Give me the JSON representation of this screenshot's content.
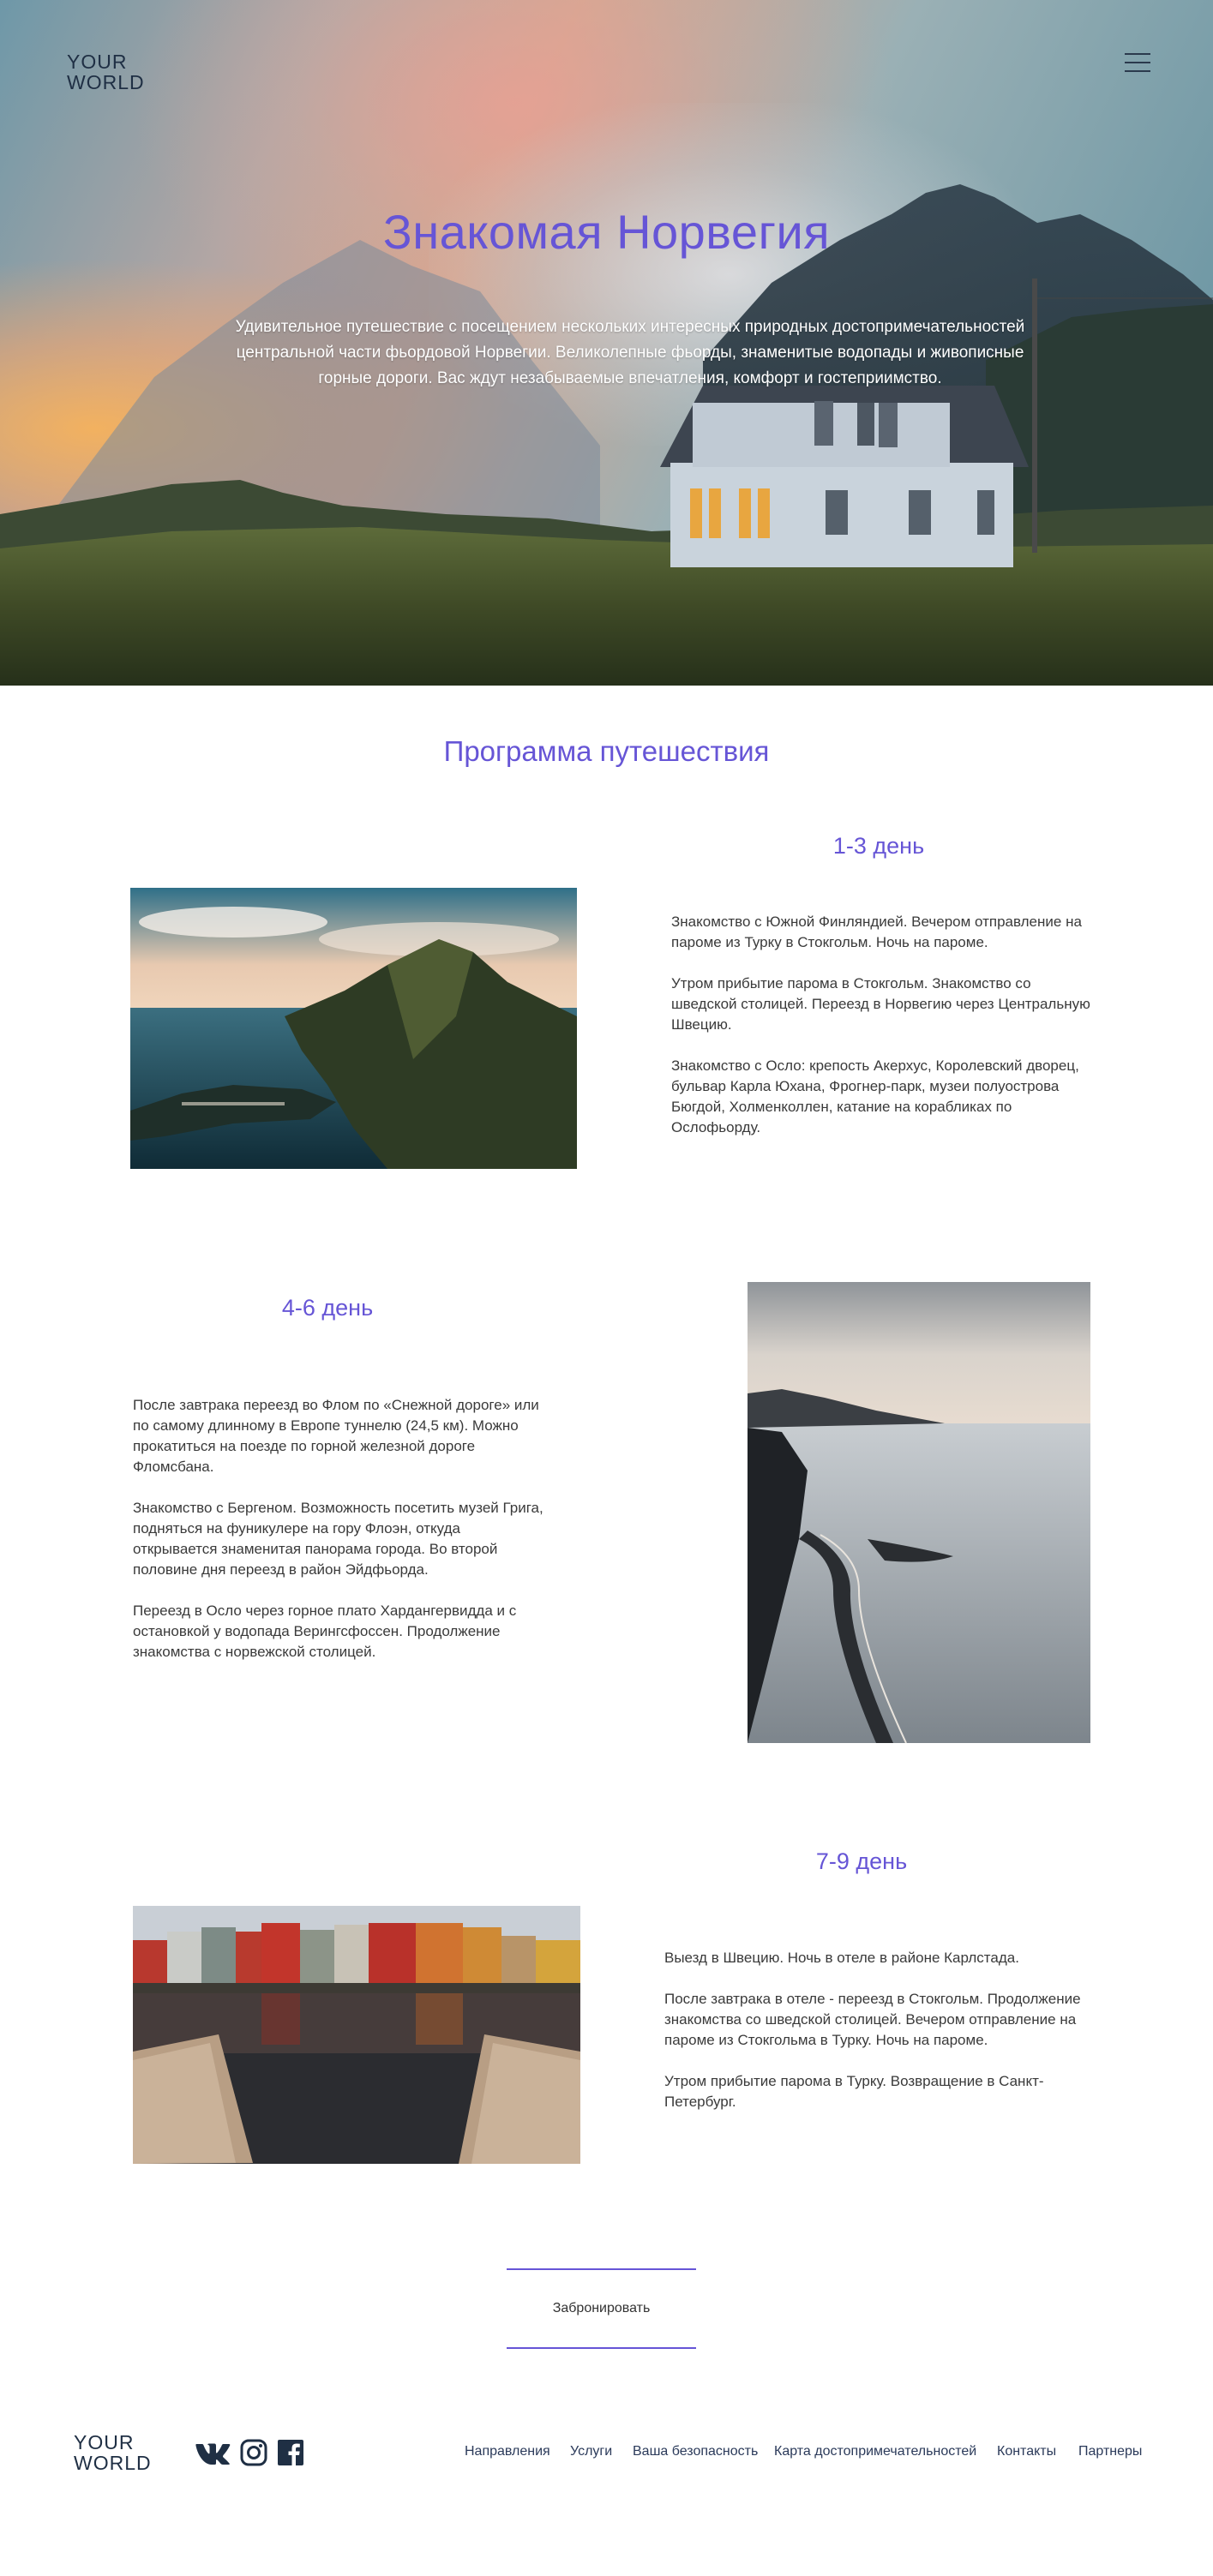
{
  "header": {
    "logo_line1": "YOUR",
    "logo_line2": "WORLD"
  },
  "hero": {
    "title": "Знакомая Норвегия",
    "description": "Удивительное путешествие с посещением нескольких интересных природных достопримечательностей центральной части фьордовой Норвегии. Великолепные фьорды, знаменитые водопады и живописные горные дороги. Вас ждут незабываемые впечатления, комфорт и гостеприимство."
  },
  "program": {
    "title": "Программа путешествия",
    "days": [
      {
        "title": "1-3 день",
        "paragraphs": [
          "Знакомство с Южной Финляндией. Вечером отправление на пароме из Турку в Стокгольм. Ночь на пароме.",
          "Утром прибытие парома в Стокгольм. Знакомство со шведской столицей. Переезд в Норвегию через Центральную Швецию.",
          "Знакомство с Осло: крепость Акерхус, Королевский дворец, бульвар Карла Юхана, Фрогнер-парк, музеи полуострова Бюгдой, Холменколлен, катание на корабликах по Ослофьорду."
        ]
      },
      {
        "title": "4-6 день",
        "paragraphs": [
          "После завтрака переезд во Флом по «Снежной дороге» или по самому длинному в Европе туннелю (24,5 км). Можно прокатиться на поезде по горной железной дороге Фломсбана.",
          "Знакомство с Бергеном. Возможность посетить музей Грига, подняться на фуникулере на гору Флоэн, откуда открывается знаменитая панорама города. Во второй половине дня переезд в район Эйдфьорда.",
          "Переезд в Осло через горное плато Хардангервидда и с остановкой у водопада Верингсфоссен. Продолжение знакомства с норвежской столицей."
        ]
      },
      {
        "title": "7-9 день",
        "paragraphs": [
          "Выезд в Швецию. Ночь в отеле в районе Карлстада.",
          "После завтрака в отеле - переезд в Стокгольм. Продолжение знакомства со шведской столицей. Вечером отправление на пароме из Стокгольма в Турку. Ночь на пароме.",
          "Утром прибытие парома в Турку. Возвращение в Санкт-Петербург."
        ]
      }
    ]
  },
  "booking": {
    "button_label": "Забронировать"
  },
  "footer": {
    "logo_line1": "YOUR",
    "logo_line2": "WORLD",
    "social_icons": [
      "vk-icon",
      "instagram-icon",
      "facebook-icon"
    ],
    "nav": [
      "Направления",
      "Услуги",
      "Ваша безопасность",
      "Карта достопримечательностей",
      "Контакты",
      "Партнеры"
    ]
  },
  "colors": {
    "accent": "#6655d6",
    "logo": "#1f2f44",
    "footer_link": "#2b3a5a"
  }
}
